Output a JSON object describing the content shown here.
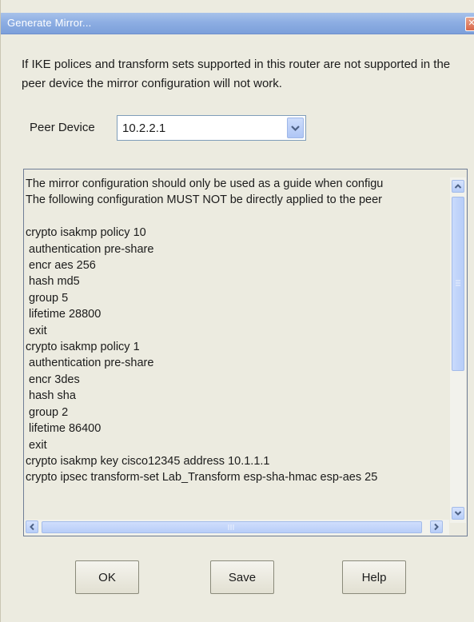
{
  "window": {
    "title": "Generate Mirror...",
    "close_icon": "close-icon"
  },
  "warning_text": "If IKE polices and transform sets supported in this router are not supported in the peer device the mirror configuration will not work.",
  "peer": {
    "label": "Peer Device",
    "selected_value": "10.2.2.1",
    "dropdown_icon": "chevron-down-icon"
  },
  "config_text": {
    "lines": [
      "The mirror configuration should only be used as a guide when configu",
      "The following configuration MUST NOT be directly applied to the peer",
      "",
      "crypto isakmp policy 10",
      " authentication pre-share",
      " encr aes 256",
      " hash md5",
      " group 5",
      " lifetime 28800",
      " exit",
      "crypto isakmp policy 1",
      " authentication pre-share",
      " encr 3des",
      " hash sha",
      " group 2",
      " lifetime 86400",
      " exit",
      "crypto isakmp key cisco12345 address 10.1.1.1",
      "crypto ipsec transform-set Lab_Transform esp-sha-hmac esp-aes 25"
    ]
  },
  "buttons": {
    "ok": "OK",
    "save": "Save",
    "help": "Help"
  }
}
